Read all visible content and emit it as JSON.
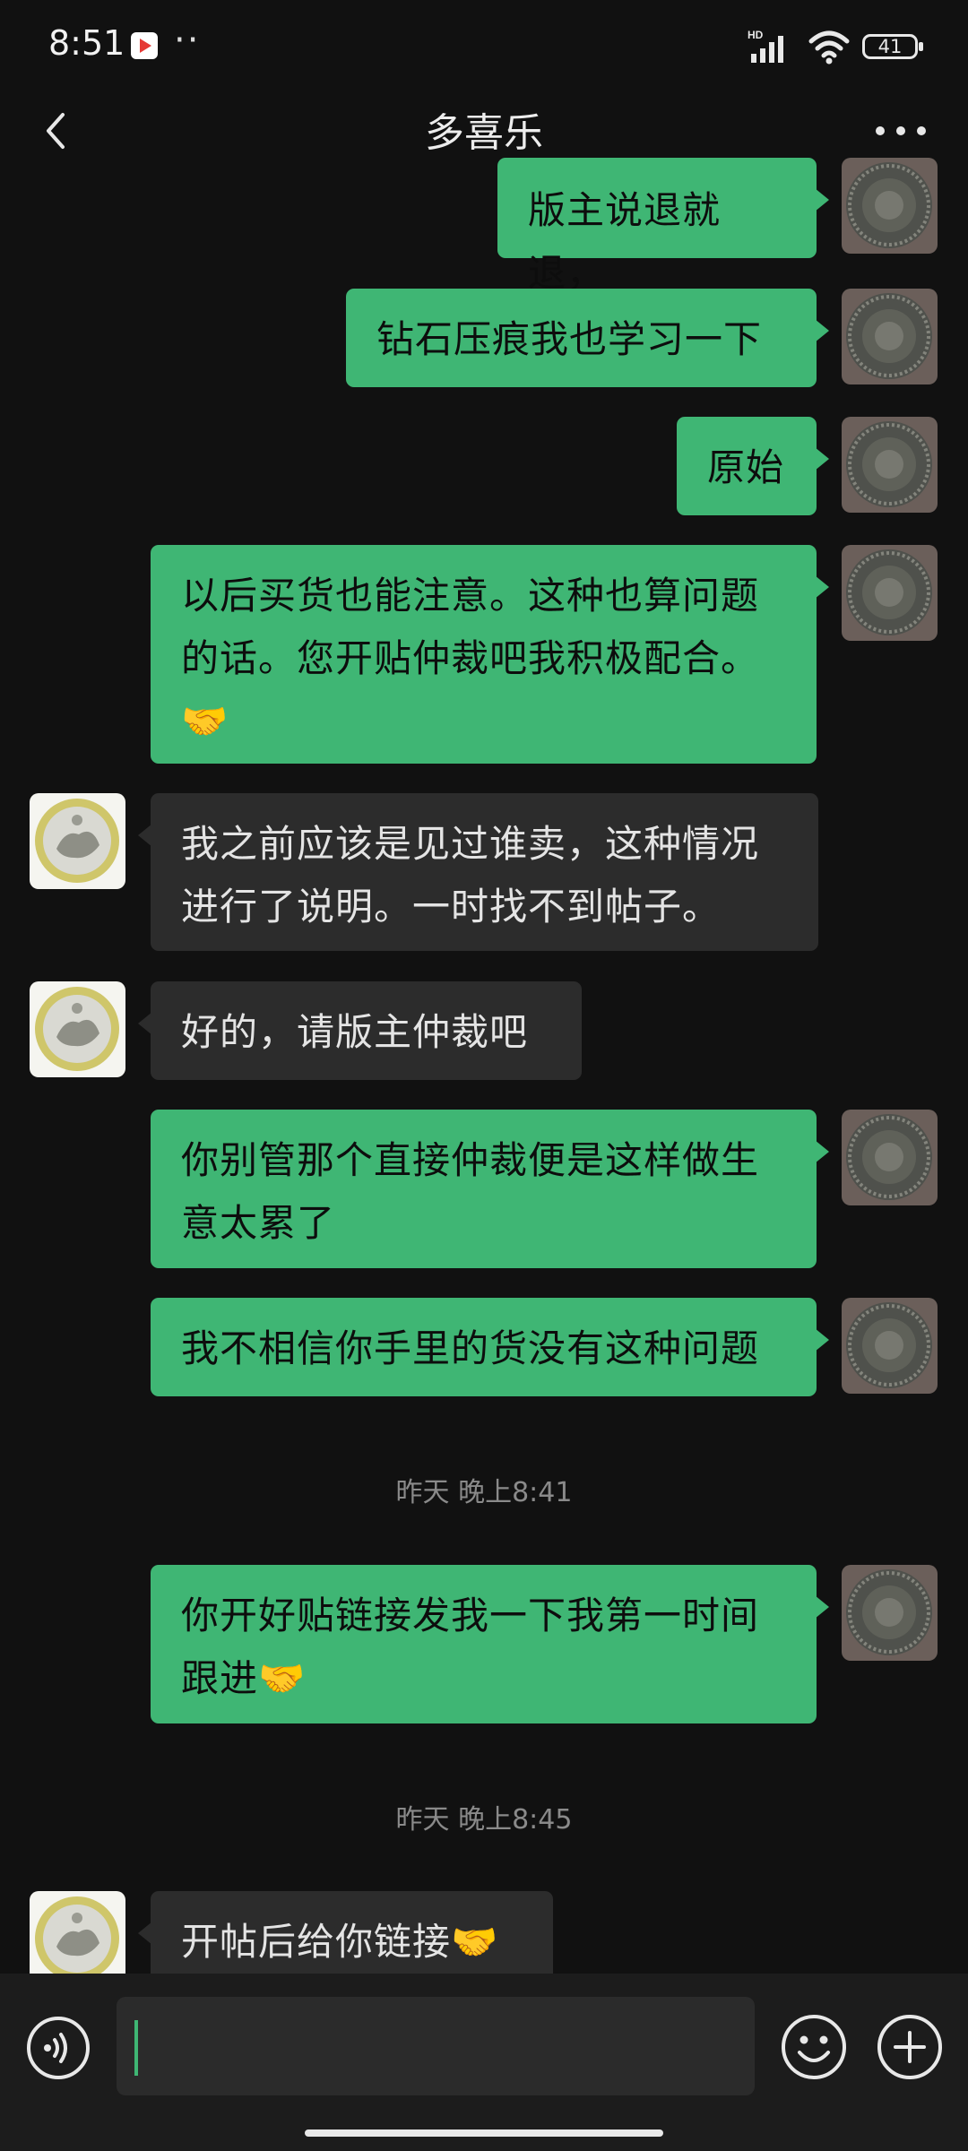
{
  "status_bar": {
    "time": "8:51",
    "dots": "··",
    "network": "HD",
    "battery": "41"
  },
  "header": {
    "title": "多喜乐"
  },
  "messages": [
    {
      "direction": "out",
      "text": "版主说退就退，"
    },
    {
      "direction": "out",
      "text": "钻石压痕我也学习一下"
    },
    {
      "direction": "out",
      "text": "原始"
    },
    {
      "direction": "out",
      "text": "以后买货也能注意。这种也算问题\n的话。您开贴仲裁吧我积极配合。\n🤝"
    },
    {
      "direction": "in",
      "text": "我之前应该是见过谁卖，这种情况\n进行了说明。一时找不到帖子。"
    },
    {
      "direction": "in",
      "text": "好的，请版主仲裁吧"
    },
    {
      "direction": "out",
      "text": "你别管那个直接仲裁便是这样做生\n意太累了"
    },
    {
      "direction": "out",
      "text": "我不相信你手里的货没有这种问题"
    },
    {
      "direction": "out",
      "text": "你开好贴链接发我一下我第一时间\n跟进🤝"
    },
    {
      "direction": "in",
      "text": "开帖后给你链接🤝"
    }
  ],
  "timestamps": [
    "昨天 晚上8:41",
    "昨天 晚上8:45"
  ],
  "icons": {
    "back": "chevron-left-icon",
    "more": "more-dots-icon",
    "voice": "voice-icon",
    "emoji": "emoji-icon",
    "plus": "plus-icon"
  },
  "colors": {
    "background": "#111111",
    "outgoing_bubble": "#3fb674",
    "incoming_bubble": "#2c2c2c",
    "input_bar": "#1c1c1c"
  }
}
